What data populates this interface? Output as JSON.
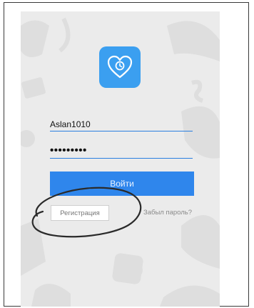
{
  "login_form": {
    "username_value": "Aslan1010",
    "password_value": "•••••••••",
    "login_button_label": "Войти",
    "register_button_label": "Регистрация",
    "forgot_password_label": "Забыл пароль?"
  },
  "colors": {
    "accent": "#2f86ec",
    "logo_bg": "#3b9ff0",
    "screen_bg": "#ebebeb"
  },
  "icons": {
    "app_logo": "heart-clock-icon"
  }
}
